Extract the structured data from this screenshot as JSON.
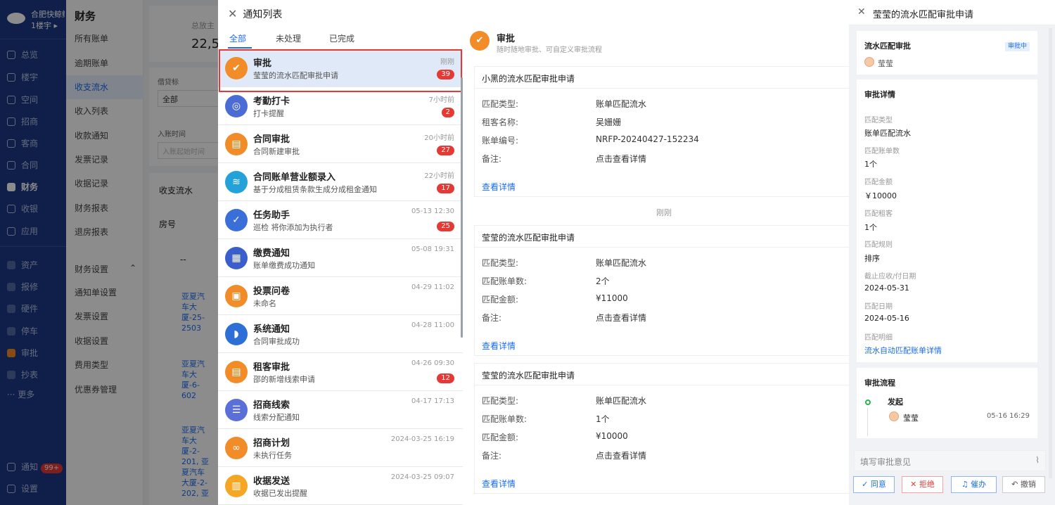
{
  "nav": {
    "company": "合肥快鲸鲸",
    "building": "1楼宇 ▸",
    "items": [
      "总览",
      "楼宇",
      "空间",
      "招商",
      "客商",
      "合同",
      "财务",
      "收银",
      "应用"
    ],
    "items2": [
      "资产",
      "报修",
      "硬件",
      "停车",
      "审批",
      "抄表"
    ],
    "more": "··· 更多",
    "notice": "通知",
    "notice_badge": "99+",
    "settings": "设置"
  },
  "submenu": {
    "header": "财务",
    "items": [
      "所有账单",
      "逾期账单",
      "收支流水",
      "收入列表",
      "收款通知",
      "发票记录",
      "收据记录",
      "财务报表",
      "退房报表"
    ],
    "group": "财务设置",
    "group_items": [
      "通知单设置",
      "发票设置",
      "收据设置",
      "费用类型",
      "优惠券管理"
    ]
  },
  "main_bg": {
    "stat_label": "总放主",
    "stat_value": "22,5",
    "filter_label": "借贷标",
    "filter_value": "全部",
    "date_label": "入账时间",
    "date_placeholder": "入账起始时间",
    "section": "收支流水",
    "col_room": "房号",
    "row_dash": "--",
    "rows": [
      [
        "亚夏汽",
        "车大",
        "厦-25-",
        "2503"
      ],
      [
        "亚夏汽",
        "车大",
        "厦-6-",
        "602"
      ],
      [
        "亚夏汽",
        "车大",
        "厦-2-",
        "201, 亚",
        "夏汽车",
        "大厦-2-",
        "202, 亚"
      ]
    ]
  },
  "notice": {
    "title": "通知列表",
    "close": "✕",
    "tabs": [
      "全部",
      "未处理",
      "已完成"
    ],
    "items": [
      {
        "title": "审批",
        "sub": "莹莹的流水匹配审批申请",
        "time": "刚刚",
        "badge": "39",
        "color": "#f28c28",
        "glyph": "✔"
      },
      {
        "title": "考勤打卡",
        "sub": "打卡提醒",
        "time": "7小时前",
        "badge": "2",
        "color": "#4a6cd4",
        "glyph": "◎"
      },
      {
        "title": "合同审批",
        "sub": "合同新建审批",
        "time": "20小时前",
        "badge": "27",
        "color": "#f28c28",
        "glyph": "▤"
      },
      {
        "title": "合同账单营业额录入",
        "sub": "基于分成租赁条款生成分成租金通知",
        "time": "22小时前",
        "badge": "17",
        "color": "#22a2d8",
        "glyph": "≋"
      },
      {
        "title": "任务助手",
        "sub": "巡检 将你添加为执行者",
        "time": "05-13 12:30",
        "badge": "25",
        "color": "#3a6fd8",
        "glyph": "✓"
      },
      {
        "title": "缴费通知",
        "sub": "账单缴费成功通知",
        "time": "05-08 19:31",
        "badge": "",
        "color": "#3a5fcc",
        "glyph": "▦"
      },
      {
        "title": "投票问卷",
        "sub": "未命名",
        "time": "04-29 11:02",
        "badge": "",
        "color": "#f28c28",
        "glyph": "▣"
      },
      {
        "title": "系统通知",
        "sub": "合同审批成功",
        "time": "04-28 11:00",
        "badge": "",
        "color": "#2d6fd6",
        "glyph": "◗"
      },
      {
        "title": "租客审批",
        "sub": "邵的新增线索申请",
        "time": "04-26 09:30",
        "badge": "12",
        "color": "#f28c28",
        "glyph": "▤"
      },
      {
        "title": "招商线索",
        "sub": "线索分配通知",
        "time": "04-17 17:13",
        "badge": "",
        "color": "#5a6fd8",
        "glyph": "☰"
      },
      {
        "title": "招商计划",
        "sub": "未执行任务",
        "time": "2024-03-25 16:19",
        "badge": "",
        "color": "#f28c28",
        "glyph": "∞"
      },
      {
        "title": "收据发送",
        "sub": "收据已发出提醒",
        "time": "2024-03-25 09:07",
        "badge": "",
        "color": "#f5a623",
        "glyph": "▥"
      }
    ],
    "detail_head": {
      "title": "审批",
      "sub": "随时随地审批、可自定义审批流程"
    },
    "timesep": "刚刚",
    "cards": [
      {
        "title": "小黑的流水匹配审批申请",
        "rows": [
          [
            "匹配类型:",
            "账单匹配流水"
          ],
          [
            "租客名称:",
            "吴姗姗"
          ],
          [
            "账单编号:",
            "NRFP-20240427-152234"
          ],
          [
            "备注:",
            "点击查看详情"
          ]
        ],
        "link": "查看详情"
      },
      {
        "title": "莹莹的流水匹配审批申请",
        "rows": [
          [
            "匹配类型:",
            "账单匹配流水"
          ],
          [
            "匹配账单数:",
            "2个"
          ],
          [
            "匹配金额:",
            "¥11000"
          ],
          [
            "备注:",
            "点击查看详情"
          ]
        ],
        "link": "查看详情"
      },
      {
        "title": "莹莹的流水匹配审批申请",
        "rows": [
          [
            "匹配类型:",
            "账单匹配流水"
          ],
          [
            "匹配账单数:",
            "1个"
          ],
          [
            "匹配金额:",
            "¥10000"
          ],
          [
            "备注:",
            "点击查看详情"
          ]
        ],
        "link": "查看详情"
      }
    ]
  },
  "approval": {
    "title": "莹莹的流水匹配审批申请",
    "type": "流水匹配审批",
    "status": "审批中",
    "user": "莹莹",
    "detail_header": "审批详情",
    "fields": [
      {
        "label": "匹配类型",
        "value": "账单匹配流水"
      },
      {
        "label": "匹配账单数",
        "value": "1个"
      },
      {
        "label": "匹配金额",
        "value": "￥10000"
      },
      {
        "label": "匹配租客",
        "value": "1个"
      },
      {
        "label": "匹配规则",
        "value": "排序"
      },
      {
        "label": "截止应收/付日期",
        "value": "2024-05-31"
      },
      {
        "label": "匹配日期",
        "value": "2024-05-16"
      },
      {
        "label": "匹配明细",
        "value": "流水自动匹配账单详情"
      }
    ],
    "flow_header": "审批流程",
    "flow_step": "发起",
    "flow_user": "莹莹",
    "flow_time": "05-16 16:29",
    "comment_placeholder": "填写审批意见",
    "buttons": [
      "✓ 同意",
      "✕ 拒绝",
      "♫ 催办",
      "↶ 撤销"
    ]
  }
}
